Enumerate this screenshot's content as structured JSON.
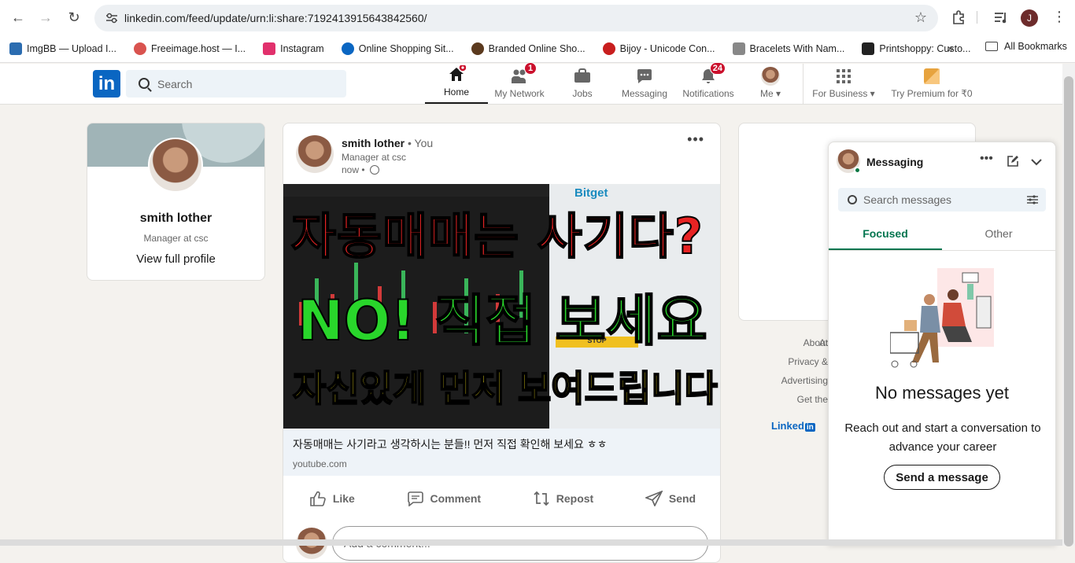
{
  "browser": {
    "url": "linkedin.com/feed/update/urn:li:share:7192413915643842560/",
    "profile_initial": "J",
    "bookmarks": [
      {
        "label": "ImgBB — Upload I...",
        "color": "#2b6cb0"
      },
      {
        "label": "Freeimage.host — I...",
        "color": "#d9534f"
      },
      {
        "label": "Instagram",
        "color": "#e1306c"
      },
      {
        "label": "Online Shopping Sit...",
        "color": "#0a66c2"
      },
      {
        "label": "Branded Online Sho...",
        "color": "#5b3a1e"
      },
      {
        "label": "Bijoy - Unicode Con...",
        "color": "#c81e1e"
      },
      {
        "label": "Bracelets With Nam...",
        "color": "#888888"
      },
      {
        "label": "Printshoppy: Custo...",
        "color": "#222222"
      }
    ],
    "all_bookmarks": "All Bookmarks"
  },
  "linkedin": {
    "logo": "in",
    "search_placeholder": "Search",
    "nav": [
      {
        "label": "Home",
        "badge": ""
      },
      {
        "label": "My Network",
        "badge": "1"
      },
      {
        "label": "Jobs",
        "badge": ""
      },
      {
        "label": "Messaging",
        "badge": ""
      },
      {
        "label": "Notifications",
        "badge": "24"
      },
      {
        "label": "Me",
        "badge": ""
      },
      {
        "label": "For Business",
        "badge": ""
      },
      {
        "label": "Try Premium for ₹0",
        "badge": ""
      }
    ]
  },
  "profile": {
    "name": "smith lother",
    "headline": "Manager at csc",
    "view_link": "View full profile"
  },
  "post": {
    "author": "smith lother",
    "you": "• You",
    "headline": "Manager at csc",
    "time": "now •",
    "thumb_line1": "자동매매는 사기다?",
    "thumb_line2": "NO! 직접 보세요",
    "thumb_line3": "자신있게 먼저 보여드립니다",
    "thumb_brand": "Bitget",
    "thumb_stop": "STOP",
    "link_title": "자동매매는 사기라고 생각하시는 분들!! 먼저 직접 확인해 보세요 ㅎㅎ",
    "link_domain": "youtube.com",
    "actions": [
      "Like",
      "Comment",
      "Repost",
      "Send"
    ],
    "comment_placeholder": "Add a comment..."
  },
  "footer_links": [
    "About",
    "Ac",
    "Privacy &",
    "Advertising",
    "Get the"
  ],
  "footer_brand": "Linked",
  "messaging": {
    "title": "Messaging",
    "search_placeholder": "Search messages",
    "tabs": [
      "Focused",
      "Other"
    ],
    "empty_title": "No messages yet",
    "empty_desc": "Reach out and start a conversation to advance your career",
    "send_button": "Send a message"
  }
}
